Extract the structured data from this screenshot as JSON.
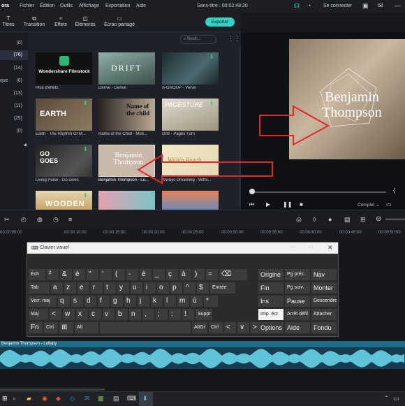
{
  "app": {
    "brand_fragment": "ora",
    "title": "Sans-titre : 00:02:48:20",
    "signin": "Se connecter"
  },
  "menu": [
    "Fichier",
    "Édition",
    "Outils",
    "Affichage",
    "Exportation",
    "Aide"
  ],
  "toolbar": {
    "items": [
      "Titres",
      "Transition",
      "Effets",
      "Éléments",
      "Écran partagé"
    ],
    "export_label": "Exporter"
  },
  "search": {
    "placeholder": "Rech..."
  },
  "categories": {
    "counts": [
      "(0)",
      "(76)",
      "(14)",
      "(6)",
      "(13)",
      "(11)",
      "(25)",
      "(0)"
    ],
    "fragment": "que"
  },
  "media_items": [
    {
      "thumb_text": "Wondershare Filmstock",
      "caption": "Plus d'effets"
    },
    {
      "thumb_text": "DRIFT",
      "caption": "Dérive - Dérive"
    },
    {
      "thumb_text": "",
      "caption": "A-GROUP - Verve"
    },
    {
      "thumb_text": "EARTH",
      "caption": "Earth - The Rhythm Of M..."
    },
    {
      "thumb_text": "Name of the child",
      "caption": "Name of the Child - Moti..."
    },
    {
      "thumb_text": "PAGESTURE",
      "caption": "Drift - Pages Turn"
    },
    {
      "thumb_text": "GO GOES",
      "caption": "Living Pulse - Go Goes"
    },
    {
      "thumb_text": "Benjamin Thompson",
      "caption": "Benjamin Thompson - Lu..."
    },
    {
      "thumb_text": "Within Reach",
      "caption": "Always Dreaming - Withi..."
    },
    {
      "thumb_text": "WOODEN",
      "caption": ""
    },
    {
      "thumb_text": "",
      "caption": ""
    },
    {
      "thumb_text": "",
      "caption": ""
    }
  ],
  "preview": {
    "title_line1": "Benjamin",
    "title_line2": "Thompson",
    "quality": "Complet"
  },
  "ruler": [
    "00:00:05:00",
    "00:00:10:00",
    "00:00:15:00",
    "00:00:20:00",
    "00:00:25:00",
    "00:00:30:00",
    "00:00:35:00",
    "00:00:40:00",
    "00:00:45:00",
    "00:00:50:00"
  ],
  "keyboard": {
    "title": "Clavier visuel",
    "rows": [
      [
        "Éch",
        "²",
        "&",
        "é",
        "\"",
        "'",
        "(",
        "-",
        "è",
        "_",
        "ç",
        "à",
        ")",
        "=",
        "⌫"
      ],
      [
        "Tab",
        "a",
        "z",
        "e",
        "r",
        "t",
        "y",
        "u",
        "i",
        "o",
        "p",
        "^",
        "$",
        "Entrée"
      ],
      [
        "Verr. maj",
        "q",
        "s",
        "d",
        "f",
        "g",
        "h",
        "j",
        "k",
        "l",
        "m",
        "ù",
        "*"
      ],
      [
        "Maj",
        "<",
        "w",
        "x",
        "c",
        "v",
        "b",
        "n",
        ",",
        ";",
        ":",
        "!",
        "Suppr"
      ],
      [
        "Fn",
        "Ctrl",
        "⊞",
        "Alt",
        "",
        "AltGr",
        "Ctrl",
        "<",
        "∨",
        ">",
        "≡"
      ]
    ],
    "nav": [
      [
        "Origine",
        "Pg préc.",
        "Nav"
      ],
      [
        "Fin",
        "Pg suiv.",
        "Monter"
      ],
      [
        "Ins",
        "Pause",
        "Descendre"
      ],
      [
        "Imp. écr.",
        "Arrêt défil",
        "Attacher"
      ],
      [
        "Options",
        "Aide",
        "Fondu"
      ]
    ]
  },
  "audio": {
    "label": "Benjamin Thompson - Lullaby"
  },
  "colors": {
    "accent": "#34d1c5",
    "arrow": "#e52528",
    "bg": "#17191e"
  }
}
